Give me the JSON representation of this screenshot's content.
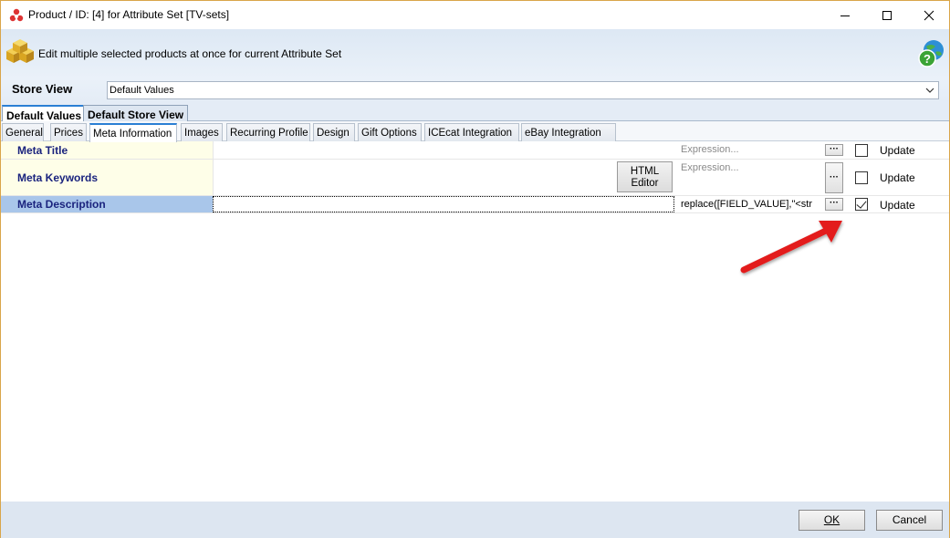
{
  "window": {
    "title": "Product / ID: [4] for Attribute Set [TV-sets]"
  },
  "header": {
    "description": "Edit multiple selected products at once for current Attribute Set"
  },
  "store_view": {
    "label": "Store View",
    "selected": "Default Values"
  },
  "top_tabs": [
    {
      "label": "Default Values",
      "active": true
    },
    {
      "label": "Default Store View",
      "active": false
    }
  ],
  "sub_tabs": [
    {
      "label": "General"
    },
    {
      "label": "Prices"
    },
    {
      "label": "Meta Information"
    },
    {
      "label": "Images"
    },
    {
      "label": "Recurring Profile"
    },
    {
      "label": "Design"
    },
    {
      "label": "Gift Options"
    },
    {
      "label": "ICEcat Integration"
    },
    {
      "label": "eBay Integration"
    }
  ],
  "rows": [
    {
      "label": "Meta Title",
      "expression": "Expression...",
      "update_label": "Update",
      "update_checked": false
    },
    {
      "label": "Meta Keywords",
      "expression": "Expression...",
      "update_label": "Update",
      "update_checked": false,
      "html_editor_label_1": "HTML",
      "html_editor_label_2": "Editor"
    },
    {
      "label": "Meta Description",
      "expression": "replace([FIELD_VALUE],\"<str",
      "update_label": "Update",
      "update_checked": true
    }
  ],
  "dots_label": "···",
  "footer": {
    "ok_label": "OK",
    "cancel_label": "Cancel"
  },
  "colors": {
    "accent": "#2a7fd4",
    "arrow": "#e31e1e",
    "label_text": "#1a237e",
    "label_bg": "#fefee8",
    "selected_bg": "#a9c6ea"
  }
}
